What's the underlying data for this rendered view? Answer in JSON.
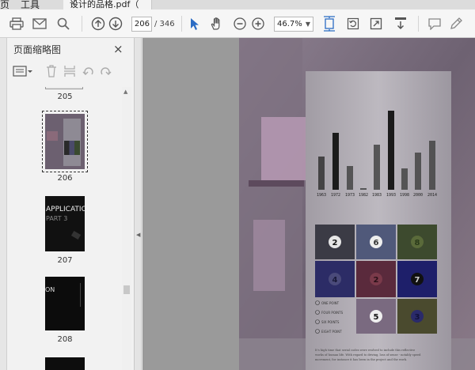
{
  "tabbar": {
    "menu_left": "页",
    "menu_tools": "工具",
    "document_tab": "设计的品格.pdf（",
    "close_glyph": "×"
  },
  "toolbar": {
    "current_page": "206",
    "page_count": "/ 346",
    "zoom": "46.7%",
    "icons": [
      "print-icon",
      "mail-icon",
      "search-icon",
      "prev-page-icon",
      "next-page-icon",
      "select-arrow-icon",
      "hand-icon",
      "zoom-out-icon",
      "zoom-in-icon",
      "fit-page-icon",
      "rotate-icon",
      "fullscreen-icon",
      "scroll-mode-icon",
      "comment-icon",
      "sign-icon"
    ],
    "accent": "#2b6cc4"
  },
  "sidebar": {
    "title": "页面缩略图",
    "close_glyph": "×",
    "thumbnails": [
      {
        "label": "205"
      },
      {
        "label": "206"
      },
      {
        "label": "207",
        "text_line1": "APPLICATIO",
        "text_line2": "PART 3"
      },
      {
        "label": "208",
        "text_line1": "ON"
      }
    ]
  },
  "page_content": {
    "years": [
      "1963",
      "1972",
      "1973",
      "1982",
      "1983",
      "1993",
      "1998",
      "2000",
      "2014"
    ],
    "tile_numbers": [
      "2",
      "6",
      "8",
      "4",
      "2",
      "7",
      "",
      "5",
      "3"
    ],
    "legend": [
      "ONE POINT",
      "FOUR POINTS",
      "SIX POINTS",
      "EIGHT POINT"
    ],
    "caption": "It's high time that serial codes were evolved to include this reflective works of human life. With regard to driving, loss of sense - notably speed movement, for instance it has been in the project and the work."
  }
}
